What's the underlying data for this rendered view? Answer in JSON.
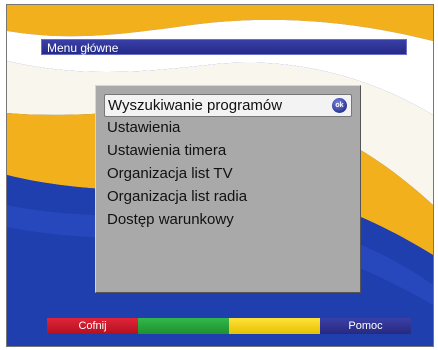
{
  "header": {
    "title": "Menu główne"
  },
  "menu": {
    "items": [
      {
        "label": "Wyszukiwanie programów"
      },
      {
        "label": "Ustawienia"
      },
      {
        "label": "Ustawienia timera"
      },
      {
        "label": "Organizacja list TV"
      },
      {
        "label": "Organizacja list radia"
      },
      {
        "label": "Dostęp warunkowy"
      }
    ],
    "selected_index": 0,
    "ok_icon": {
      "name": "ok-icon",
      "label": "ok"
    }
  },
  "buttons": {
    "red": {
      "label": "Cofnij",
      "color": "#d01a2e"
    },
    "green": {
      "label": "",
      "color": "#2aa63e"
    },
    "yellow": {
      "label": "",
      "color": "#f5d313"
    },
    "blue": {
      "label": "Pomoc",
      "color": "#2f3392"
    }
  },
  "colors": {
    "background_blue": "#1f3fae",
    "background_yellow": "#f2b01c",
    "panel_gray": "#a9a9a9",
    "title_bar": "#2f3392"
  }
}
